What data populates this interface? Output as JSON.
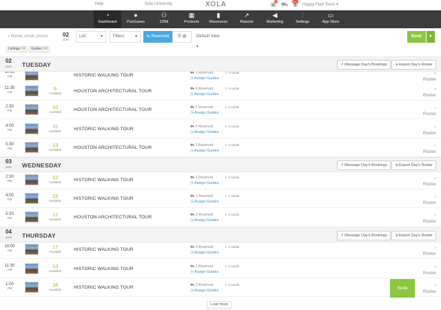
{
  "topbar": {
    "help": "Help",
    "university": "Xola University",
    "logo": "XOLA",
    "cart_badge": "3",
    "notif_badge": "99+",
    "account": "Happy Feet Tours"
  },
  "nav": {
    "items": [
      {
        "label": "Dashboard",
        "icon": "dashboard-icon",
        "glyph": "◔"
      },
      {
        "label": "Purchases",
        "icon": "purchases-icon",
        "glyph": "●"
      },
      {
        "label": "CRM",
        "icon": "crm-icon",
        "glyph": "⚇"
      },
      {
        "label": "Products",
        "icon": "products-icon",
        "glyph": "▦"
      },
      {
        "label": "Resources",
        "icon": "resources-icon",
        "glyph": "▮"
      },
      {
        "label": "Reports",
        "icon": "reports-icon",
        "glyph": "↗"
      },
      {
        "label": "Marketing",
        "icon": "marketing-icon",
        "glyph": "◀"
      },
      {
        "label": "Settings",
        "icon": "settings-icon",
        "glyph": "⫶"
      },
      {
        "label": "App Store",
        "icon": "app-store-icon",
        "glyph": "▭"
      }
    ]
  },
  "filters": {
    "search_placeholder": "Name, email, phone",
    "date_day": "02",
    "date_month": "JUN",
    "view_mode": "List",
    "filters_label": "Filters",
    "reserved_label": "Reserved",
    "default_view": "Default View",
    "book_label": "Book",
    "listings_tag_label": "Listings",
    "listings_tag_value": "All",
    "guides_tag_label": "Guides",
    "guides_tag_value": "All"
  },
  "days": [
    {
      "day": "02",
      "month": "JUN",
      "weekday": "TUESDAY",
      "message_btn": "Message Day's Bookings",
      "export_btn": "Export Day's Roster",
      "rows": [
        {
          "time": "10:00",
          "ampm": "AM",
          "avail": "",
          "avail_label": "",
          "name": "HISTORIC WALKING TOUR",
          "reserved": "3 Reserved",
          "adults": "3 Adults",
          "guide": "Assign Guides",
          "roster": "Roster"
        },
        {
          "time": "11:30",
          "ampm": "AM",
          "avail": "9",
          "avail_label": "Available",
          "name": "HOUSTON ARCHITECTURAL TOUR",
          "reserved": "6 Reserved",
          "adults": "3 Adults",
          "guide": "Assign Guides",
          "roster": "Roster"
        },
        {
          "time": "2:30",
          "ampm": "PM",
          "avail": "10",
          "avail_label": "Available",
          "name": "HOUSTON ARCHITECTURAL TOUR",
          "reserved": "5 Reserved",
          "adults": "3 Adults",
          "guide": "Assign Guides",
          "roster": "Roster"
        },
        {
          "time": "4:00",
          "ampm": "PM",
          "avail": "15",
          "avail_label": "Available",
          "name": "HISTORIC WALKING TOUR",
          "reserved": "5 Reserved",
          "adults": "2 Adults",
          "guide": "Assign Guides",
          "roster": "Roster"
        },
        {
          "time": "5:30",
          "ampm": "PM",
          "avail": "13",
          "avail_label": "Available",
          "name": "HOUSTON ARCHITECTURAL TOUR",
          "reserved": "3 Reserved",
          "adults": "3 Adults",
          "guide": "Assign Guides",
          "roster": "Roster"
        }
      ]
    },
    {
      "day": "03",
      "month": "JUN",
      "weekday": "WEDNESDAY",
      "message_btn": "Message Day's Bookings",
      "export_btn": "Export Day's Roster",
      "rows": [
        {
          "time": "2:30",
          "ampm": "PM",
          "avail": "12",
          "avail_label": "Available",
          "name": "HISTORIC WALKING TOUR",
          "reserved": "3 Reserved",
          "adults": "2 Adults",
          "guide": "Assign Guides",
          "roster": "Roster"
        },
        {
          "time": "4:00",
          "ampm": "PM",
          "avail": "19",
          "avail_label": "Available",
          "name": "HISTORIC WALKING TOUR",
          "reserved": "1 Reserved",
          "adults": "1 Adults",
          "guide": "Assign Guides",
          "roster": "Roster"
        },
        {
          "time": "5:30",
          "ampm": "PM",
          "avail": "12",
          "avail_label": "Available",
          "name": "HOUSTON ARCHITECTURAL TOUR",
          "reserved": "3 Reserved",
          "adults": "2 Adults",
          "guide": "Assign Guides",
          "roster": "Roster"
        }
      ]
    },
    {
      "day": "04",
      "month": "JUN",
      "weekday": "THURSDAY",
      "message_btn": "Message Day's Bookings",
      "export_btn": "Export Day's Roster",
      "rows": [
        {
          "time": "10:00",
          "ampm": "AM",
          "avail": "17",
          "avail_label": "Available",
          "name": "HISTORIC WALKING TOUR",
          "reserved": "3 Reserved",
          "adults": "2 Adults",
          "guide": "Assign Guides",
          "roster": "Roster"
        },
        {
          "time": "11:30",
          "ampm": "AM",
          "avail": "13",
          "avail_label": "Available",
          "name": "HISTORIC WALKING TOUR",
          "reserved": "2 Reserved",
          "adults": "2 Adults",
          "guide": "Assign Guides",
          "roster": "Roster"
        },
        {
          "time": "1:00",
          "ampm": "PM",
          "avail": "18",
          "avail_label": "Available",
          "name": "HISTORIC WALKING TOUR",
          "reserved": "2 Reserved",
          "adults": "2 Adults",
          "guide": "Assign Guides",
          "roster": "Roster"
        }
      ]
    }
  ],
  "floating_book": "Book",
  "load_more": "Load more",
  "colors": {
    "accent_green": "#8dc63f",
    "accent_blue": "#4aa8e0",
    "nav_bg": "#3c3c3c",
    "avail_gold": "#c9a227",
    "link_blue": "#3b8fc9"
  }
}
